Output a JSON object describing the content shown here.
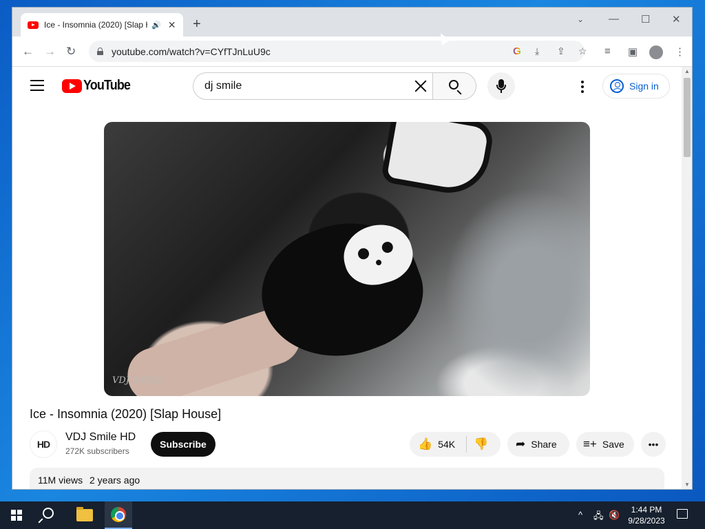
{
  "browser": {
    "tab_title": "Ice - Insomnia (2020) [Slap H",
    "new_tab": "+",
    "url": "youtube.com/watch?v=CYfTJnLuU9c"
  },
  "youtube": {
    "logo_text": "YouTube",
    "search_value": "dj smile",
    "signin_label": "Sign in",
    "video": {
      "watermark": "VDJ SMILE",
      "title": "Ice - Insomnia (2020) [Slap House]"
    },
    "channel": {
      "avatar_text": "HD",
      "name": "VDJ Smile HD",
      "subscribers": "272K subscribers",
      "subscribe_label": "Subscribe"
    },
    "actions": {
      "likes": "54K",
      "share_label": "Share",
      "save_label": "Save"
    },
    "description": {
      "views": "11M views",
      "age": "2 years ago"
    }
  },
  "taskbar": {
    "time": "1:44 PM",
    "date": "9/28/2023"
  },
  "icons": [
    "youtube-favicon",
    "audio-icon",
    "close-icon",
    "back-icon",
    "forward-icon",
    "reload-icon",
    "lock-icon",
    "google-lens-icon",
    "install-icon",
    "share-page-icon",
    "star-icon",
    "reading-list-icon",
    "side-panel-icon",
    "profile-icon",
    "menu-icon",
    "hamburger-icon",
    "search-icon",
    "mic-icon",
    "signin-person-icon",
    "like-icon",
    "dislike-icon",
    "share-icon",
    "save-playlist-icon",
    "more-icon",
    "windows-start-icon",
    "taskbar-search-icon",
    "file-explorer-icon",
    "chrome-icon",
    "network-icon",
    "volume-muted-icon",
    "notification-icon"
  ]
}
